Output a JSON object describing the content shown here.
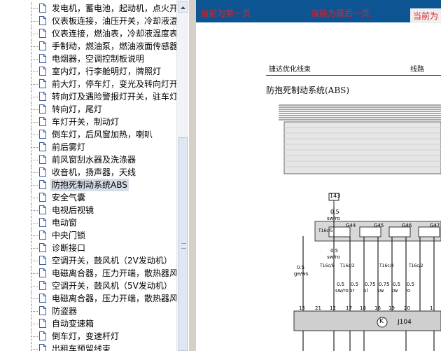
{
  "tree": {
    "items": [
      {
        "label": "发电机，蓄电池，起动机，点火开"
      },
      {
        "label": "仪表板连接，油压开关，冷却液温"
      },
      {
        "label": "仪表连接，燃油表，冷却液温度表"
      },
      {
        "label": "手制动，燃油泵，燃油液面传感器"
      },
      {
        "label": "电烟器，空调控制板说明"
      },
      {
        "label": "室内灯，行李舱明灯，牌照灯"
      },
      {
        "label": "前大灯，停车灯，变光及转向灯开"
      },
      {
        "label": "转向灯及遇险警报灯开关，驻车灯"
      },
      {
        "label": "转向灯，尾灯"
      },
      {
        "label": "车灯开关，制动灯"
      },
      {
        "label": "倒车灯，后风窗加热，喇叭"
      },
      {
        "label": "前后雾灯"
      },
      {
        "label": "前风窗刮水器及洗涤器"
      },
      {
        "label": "收音机，扬声器，天线"
      },
      {
        "label": "防抱死制动系统ABS",
        "selected": true
      },
      {
        "label": "安全气囊"
      },
      {
        "label": "电视后视镜"
      },
      {
        "label": "电动窗"
      },
      {
        "label": "中央门锁"
      },
      {
        "label": "诊断接口"
      },
      {
        "label": "空调开关，鼓风机（2V发动机）"
      },
      {
        "label": "电磁离合器，压力开端，散热器风"
      },
      {
        "label": "空调开关，鼓风机（5V发动机）"
      },
      {
        "label": "电磁离合器，压力开端，散热器风"
      },
      {
        "label": "防盗器"
      },
      {
        "label": "自动变速箱"
      },
      {
        "label": "倒车灯，变速杆灯"
      },
      {
        "label": "出租车预留线束"
      }
    ]
  },
  "nav": {
    "first": "当前为第一页",
    "last": "当前为最后一页",
    "current": "当前为"
  },
  "document": {
    "header_left": "捷达优化线束",
    "header_right": "线路",
    "title": "防抱死制动系统(ABS)",
    "component_143": "143",
    "wire_top_size": "0.5",
    "wire_top_color": "sw/ro",
    "connectors": [
      "G44",
      "G45",
      "G46",
      "G47"
    ],
    "left_wire_size": "0.5",
    "left_wire_color": "ge/ws",
    "wire_sizes": [
      "0.5",
      "0.5",
      "0.75",
      "0.75",
      "0.5",
      "0.5"
    ],
    "wire_colors": [
      "sw/ro",
      "br",
      "bl",
      "sw",
      "sw",
      "ro"
    ],
    "pin_numbers": [
      "15",
      "21",
      "12",
      "17",
      "18",
      "16",
      "19",
      "20",
      "1"
    ],
    "unit_symbol": "K",
    "unit_code": "J104",
    "small_labels": [
      "T16c/5",
      "T16c/6",
      "T16c/3",
      "T16c/4",
      "T16c/2"
    ]
  },
  "colors": {
    "nav_bg": "#0c5592",
    "nav_text": "#e0202a",
    "selected_bg": "#d7dde8"
  }
}
